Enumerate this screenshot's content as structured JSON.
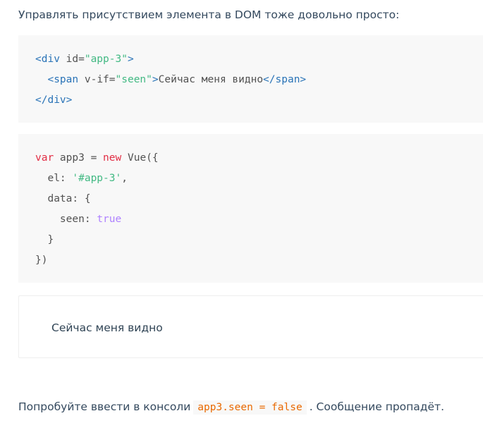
{
  "intro": "Управлять присутствием элемента в DOM тоже довольно просто:",
  "code_html": {
    "line1": {
      "open": "<div",
      "attr": " id=",
      "val": "\"app-3\"",
      "close": ">"
    },
    "line2": {
      "indent": "  ",
      "open": "<span",
      "attr": " v-if=",
      "val": "\"seen\"",
      "close": ">",
      "text": "Сейчас меня видно",
      "end": "</span>"
    },
    "line3": {
      "end": "</div>"
    }
  },
  "code_js": {
    "line1": {
      "kw": "var",
      "rest1": " app3 = ",
      "kw2": "new",
      "rest2": " Vue({"
    },
    "line2": {
      "indent": "  ",
      "key": "el: ",
      "str": "'#app-3'",
      "tail": ","
    },
    "line3": {
      "indent": "  ",
      "text": "data: {"
    },
    "line4": {
      "indent": "    ",
      "key": "seen: ",
      "bool": "true"
    },
    "line5": {
      "indent": "  ",
      "text": "}"
    },
    "line6": {
      "text": "})"
    }
  },
  "demo": {
    "text": "Сейчас меня видно"
  },
  "footer": {
    "before": "Попробуйте ввести в консоли",
    "code": "app3.seen = false",
    "after": ". Сообщение пропадёт."
  }
}
